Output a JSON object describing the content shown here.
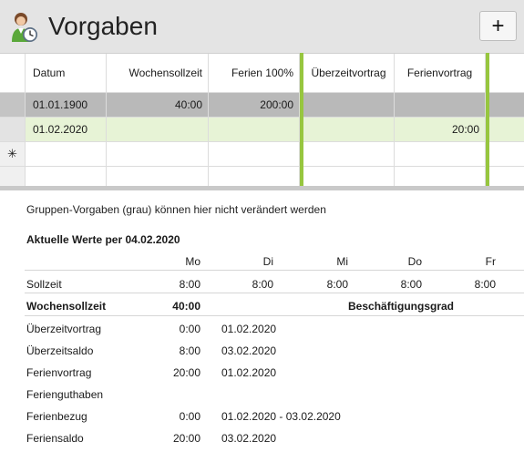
{
  "header": {
    "title": "Vorgaben",
    "icon": "user-clock-icon",
    "add_label": "+"
  },
  "grid": {
    "columns": [
      "Datum",
      "Wochensollzeit",
      "Ferien 100%",
      "Überzeitvortrag",
      "Ferienvortrag"
    ],
    "rows": [
      {
        "datum": "01.01.1900",
        "wochensollzeit": "40:00",
        "ferien": "200:00",
        "ueberzeitvortrag": "",
        "ferienvortrag": "",
        "style": "gray"
      },
      {
        "datum": "01.02.2020",
        "wochensollzeit": "",
        "ferien": "",
        "ueberzeitvortrag": "",
        "ferienvortrag": "20:00",
        "style": "green"
      }
    ],
    "new_row_marker": "✳",
    "accent_color": "#97c63f"
  },
  "info_text": "Gruppen-Vorgaben (grau) können hier nicht verändert werden",
  "current": {
    "title": "Aktuelle Werte per 04.02.2020",
    "days": [
      "Mo",
      "Di",
      "Mi",
      "Do",
      "Fr"
    ],
    "sollzeit_label": "Sollzeit",
    "sollzeit_values": [
      "8:00",
      "8:00",
      "8:00",
      "8:00",
      "8:00"
    ],
    "wochensollzeit_label": "Wochensollzeit",
    "wochensollzeit_value": "40:00",
    "beschaeftigungsgrad_label": "Beschäftigungsgrad",
    "details": [
      {
        "label": "Überzeitvortrag",
        "value": "0:00",
        "date": "01.02.2020"
      },
      {
        "label": "Überzeitsaldo",
        "value": "8:00",
        "date": "03.02.2020"
      },
      {
        "label": "Ferienvortrag",
        "value": "20:00",
        "date": "01.02.2020"
      },
      {
        "label": "Ferienguthaben",
        "value": "",
        "date": ""
      },
      {
        "label": "Ferienbezug",
        "value": "0:00",
        "date": "01.02.2020 - 03.02.2020"
      },
      {
        "label": "Feriensaldo",
        "value": "20:00",
        "date": "03.02.2020"
      }
    ]
  }
}
